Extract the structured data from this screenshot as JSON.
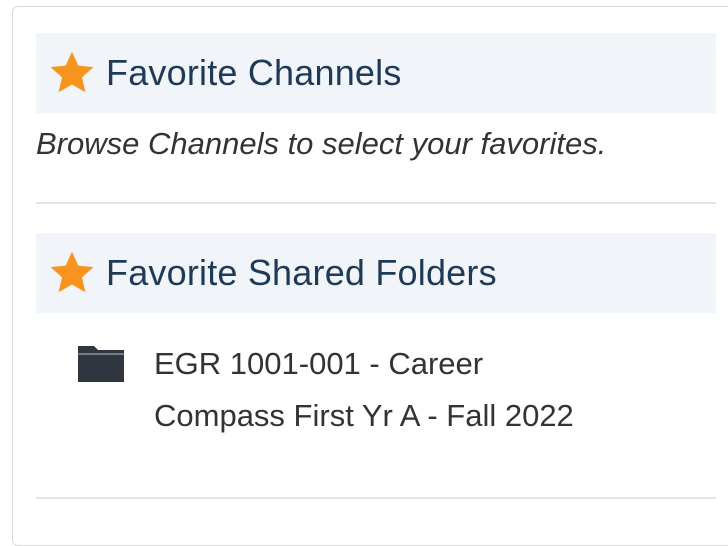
{
  "favorites": {
    "channels": {
      "title": "Favorite Channels",
      "icon": "star-icon",
      "hint": "Browse Channels to select your favorites."
    },
    "shared_folders": {
      "title": "Favorite Shared Folders",
      "icon": "star-icon",
      "items": [
        {
          "icon": "folder-icon",
          "label_line1": "EGR 1001-001 - Career",
          "label_line2": "Compass First Yr A - Fall 2022"
        }
      ]
    }
  },
  "colors": {
    "star": "#f7941d",
    "header_bg": "#f1f4f9",
    "header_text": "#1f3a57",
    "folder": "#2f3640"
  }
}
